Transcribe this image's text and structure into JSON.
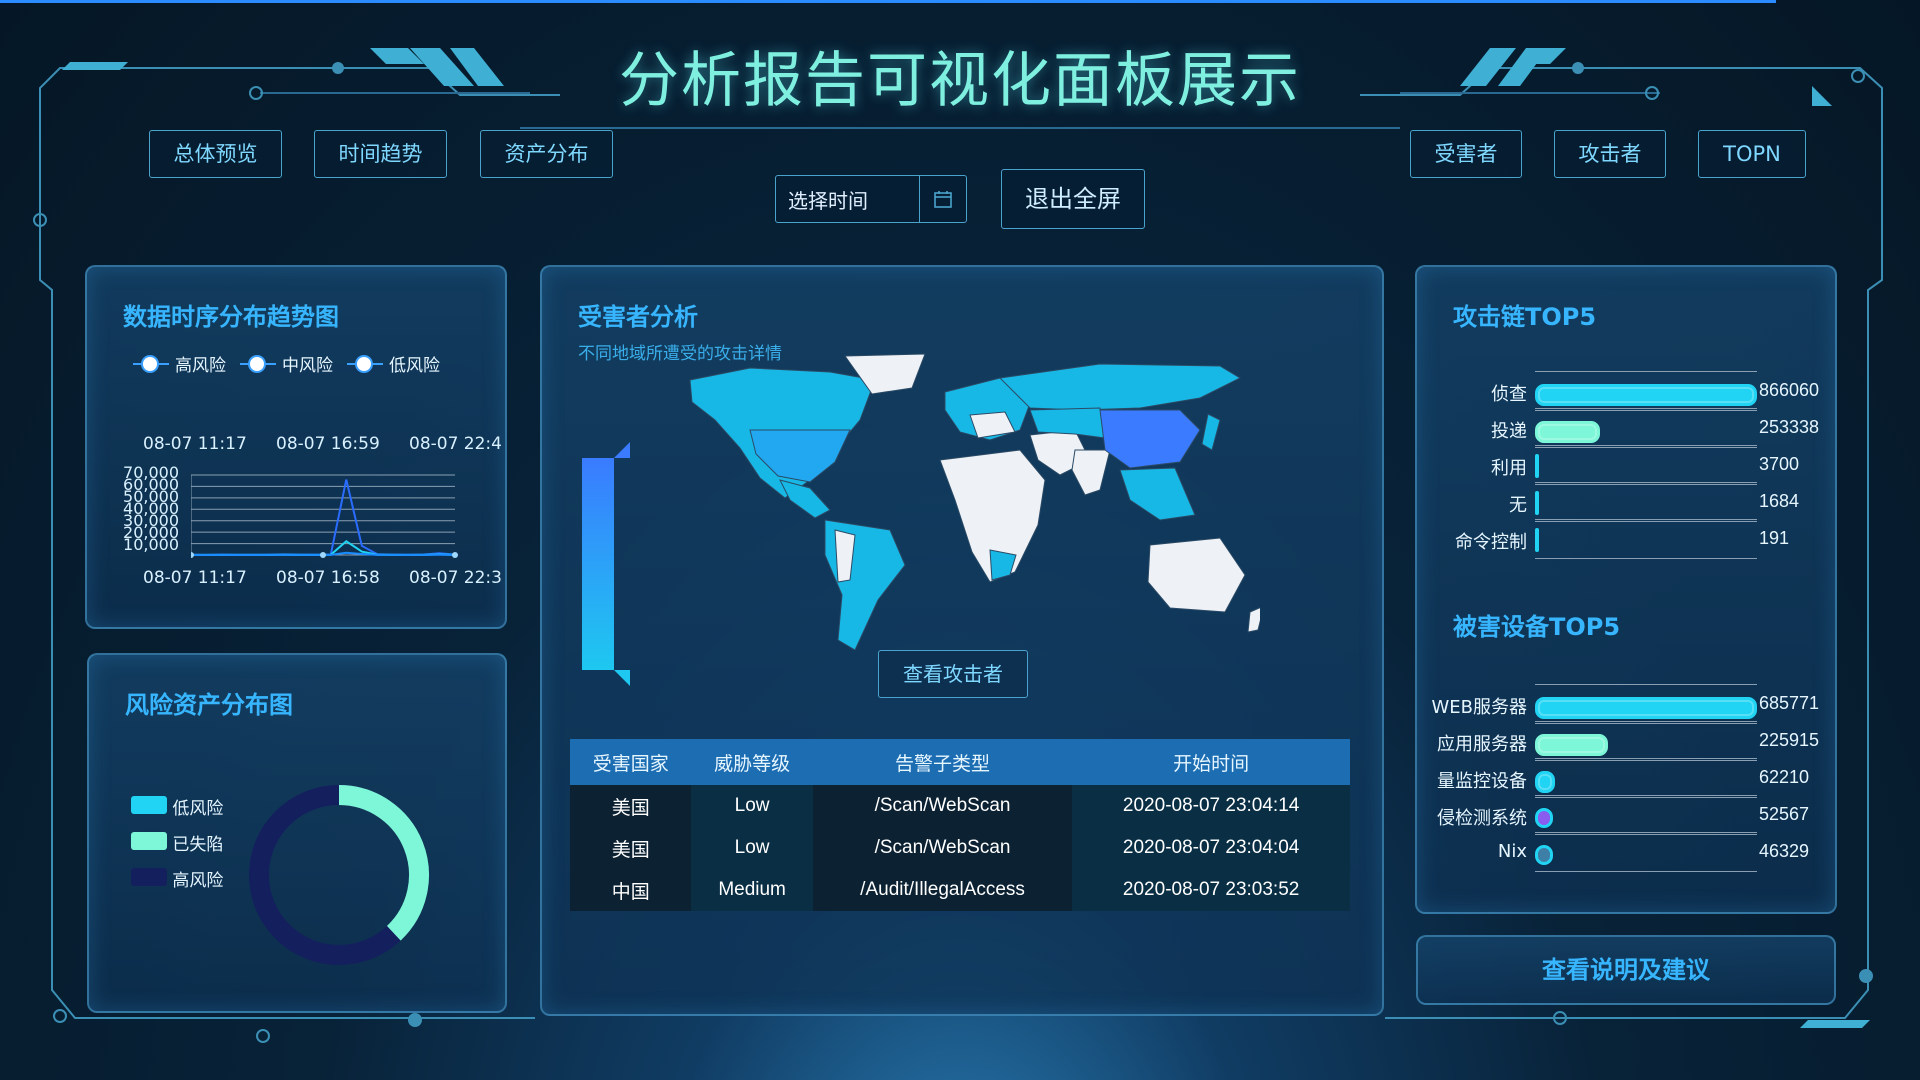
{
  "header": {
    "title": "分析报告可视化面板展示"
  },
  "nav_left": [
    "总体预览",
    "时间趋势",
    "资产分布"
  ],
  "nav_right": [
    "受害者",
    "攻击者",
    "TOPN"
  ],
  "toolbar": {
    "date_placeholder": "选择时间",
    "exit_label": "退出全屏"
  },
  "trend_panel": {
    "title": "数据时序分布趋势图",
    "legend": [
      "高风险",
      "中风险",
      "低风险"
    ],
    "top_ticks": [
      "08-07 11:17",
      "08-07 16:59",
      "08-07 22:4"
    ],
    "y_ticks": [
      "70,000",
      "60,000",
      "50,000",
      "40,000",
      "30,000",
      "20,000",
      "10,000"
    ],
    "bottom_ticks": [
      "08-07 11:17",
      "08-07 16:58",
      "08-07 22:3"
    ]
  },
  "chart_data": [
    {
      "type": "line",
      "title": "数据时序分布趋势图",
      "ylim": [
        0,
        70000
      ],
      "x": [
        "08-07 11:17",
        "08-07 16:58",
        "08-07 22:3"
      ],
      "series": [
        {
          "name": "高风险",
          "values": [
            200,
            150,
            300,
            250,
            180,
            220,
            500,
            300,
            260,
            400,
            66000,
            8000,
            600,
            300,
            250,
            400,
            1500,
            300
          ]
        },
        {
          "name": "中风险",
          "values": [
            100,
            80,
            120,
            90,
            100,
            110,
            200,
            150,
            120,
            180,
            12000,
            3000,
            200,
            120,
            100,
            150,
            600,
            100
          ]
        },
        {
          "name": "低风险",
          "values": [
            50,
            40,
            60,
            45,
            50,
            55,
            80,
            70,
            60,
            80,
            2000,
            900,
            100,
            60,
            50,
            70,
            200,
            50
          ]
        }
      ]
    },
    {
      "type": "pie",
      "title": "风险资产分布图",
      "categories": [
        "低风险",
        "已失陷",
        "高风险"
      ],
      "values": [
        0,
        38,
        62
      ]
    },
    {
      "type": "bar",
      "title": "攻击链TOP5",
      "categories": [
        "侦查",
        "投递",
        "利用",
        "无",
        "命令控制"
      ],
      "values": [
        866060,
        253338,
        3700,
        1684,
        191
      ]
    },
    {
      "type": "bar",
      "title": "被害设备TOP5",
      "categories": [
        "WEB服务器",
        "应用服务器",
        "量监控设备",
        "侵检测系统",
        "Nix"
      ],
      "values": [
        685771,
        225915,
        62210,
        52567,
        46329
      ]
    }
  ],
  "asset_panel": {
    "title": "风险资产分布图",
    "legend": [
      "低风险",
      "已失陷",
      "高风险"
    ]
  },
  "victim_panel": {
    "title": "受害者分析",
    "subtitle": "不同地域所遭受的攻击详情",
    "view_attacker_label": "查看攻击者",
    "table": {
      "headers": [
        "受害国家",
        "威胁等级",
        "告警子类型",
        "开始时间"
      ],
      "rows": [
        [
          "美国",
          "Low",
          "/Scan/WebScan",
          "2020-08-07 23:04:14"
        ],
        [
          "美国",
          "Low",
          "/Scan/WebScan",
          "2020-08-07 23:04:04"
        ],
        [
          "中国",
          "Medium",
          "/Audit/IllegalAccess",
          "2020-08-07 23:03:52"
        ]
      ]
    }
  },
  "chain_panel": {
    "title": "攻击链TOP5",
    "labels": [
      "侦查",
      "投递",
      "利用",
      "无",
      "命令控制"
    ],
    "values": [
      "866060",
      "253338",
      "3700",
      "1684",
      "191"
    ]
  },
  "device_panel": {
    "title": "被害设备TOP5",
    "labels": [
      "WEB服务器",
      "应用服务器",
      "量监控设备",
      "侵检测系统",
      "Nix"
    ],
    "values": [
      "685771",
      "225915",
      "62210",
      "52567",
      "46329"
    ]
  },
  "cta": {
    "label": "查看说明及建议"
  },
  "colors": {
    "accent": "#37b6ff",
    "cyan": "#21d4f3",
    "mint": "#7ef7d8",
    "navy": "#141f5e",
    "violet": "#8a5cf0"
  }
}
